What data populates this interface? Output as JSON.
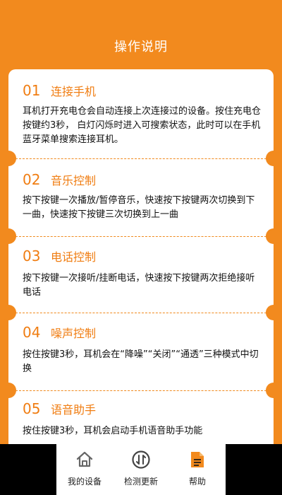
{
  "header": {
    "title": "操作说明"
  },
  "sections": [
    {
      "num": "01",
      "title": "连接手机",
      "body": "耳机打开充电仓会自动连接上次连接过的设备。按住充电仓按键约3秒， 白灯闪烁时进入可搜索状态，此时可以在手机蓝牙菜单搜索连接耳机。"
    },
    {
      "num": "02",
      "title": "音乐控制",
      "body": "按下按键一次播放/暂停音乐，快速按下按键两次切换到下一曲，快速按下按键三次切换到上一曲"
    },
    {
      "num": "03",
      "title": "电话控制",
      "body": "按下按键一次接听/挂断电话，快速按下按键两次拒绝接听电话"
    },
    {
      "num": "04",
      "title": "噪声控制",
      "body": "按住按键3秒，耳机会在“降噪”“关闭”“通透”三种模式中切换"
    },
    {
      "num": "05",
      "title": "语音助手",
      "body": "按住按键3秒，耳机会启动手机语音助手功能"
    }
  ],
  "tabbar": {
    "items": [
      {
        "label": "我的设备",
        "icon": "home-icon"
      },
      {
        "label": "检测更新",
        "icon": "update-icon"
      },
      {
        "label": "帮助",
        "icon": "document-icon"
      }
    ]
  },
  "colors": {
    "accent": "#f28a1e",
    "text": "#111111"
  }
}
